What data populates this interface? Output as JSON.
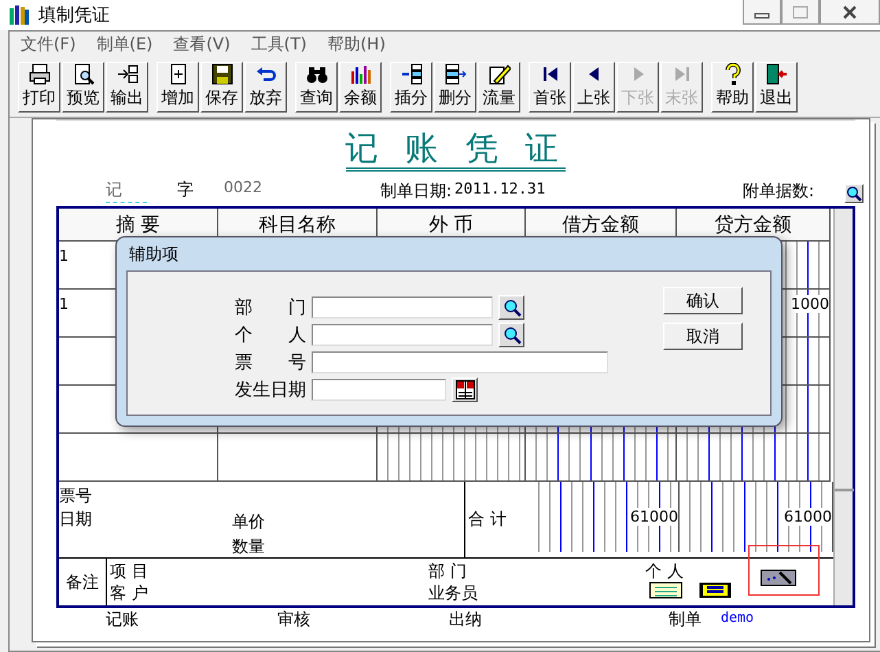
{
  "window": {
    "title": "填制凭证"
  },
  "menu": [
    {
      "label": "文件(F)"
    },
    {
      "label": "制单(E)"
    },
    {
      "label": "查看(V)"
    },
    {
      "label": "工具(T)"
    },
    {
      "label": "帮助(H)"
    }
  ],
  "toolbar": [
    {
      "buttons": [
        {
          "label": "打印",
          "disabled": false
        },
        {
          "label": "预览",
          "disabled": false
        },
        {
          "label": "输出",
          "disabled": false
        }
      ]
    },
    {
      "buttons": [
        {
          "label": "增加",
          "disabled": false
        },
        {
          "label": "保存",
          "disabled": false
        },
        {
          "label": "放弃",
          "disabled": false
        }
      ]
    },
    {
      "buttons": [
        {
          "label": "查询",
          "disabled": false
        },
        {
          "label": "余额",
          "disabled": false
        }
      ]
    },
    {
      "buttons": [
        {
          "label": "插分",
          "disabled": false
        },
        {
          "label": "删分",
          "disabled": false
        },
        {
          "label": "流量",
          "disabled": false
        }
      ]
    },
    {
      "buttons": [
        {
          "label": "首张",
          "disabled": false
        },
        {
          "label": "上张",
          "disabled": false
        },
        {
          "label": "下张",
          "disabled": true
        },
        {
          "label": "末张",
          "disabled": true
        }
      ]
    },
    {
      "buttons": [
        {
          "label": "帮助",
          "disabled": false
        },
        {
          "label": "退出",
          "disabled": false
        }
      ]
    }
  ],
  "voucher": {
    "title": "记 账 凭 证",
    "type": "记",
    "type_suffix": "字",
    "number": "0022",
    "date_label": "制单日期:",
    "date": "2011.12.31",
    "attachments_label": "附单据数:"
  },
  "table": {
    "columns": [
      "摘 要",
      "科目名称",
      "外 币",
      "借方金额",
      "贷方金额"
    ],
    "rows": [
      {
        "column_1": "1",
        "column_5": ""
      },
      {
        "column_1": "1",
        "column_5": "1000"
      }
    ]
  },
  "totals": {
    "invoice_label": "票号",
    "date_label": "日期",
    "unit_price_label": "单价",
    "quantity_label": "数量",
    "total_label": "合 计",
    "debit_total": "61000",
    "credit_total": "61000"
  },
  "remarks": {
    "label": "备注",
    "project_label": "项 目",
    "customer_label": "客 户",
    "department_label": "部 门",
    "salesperson_label": "业务员",
    "person_label": "个 人"
  },
  "signatures": [
    {
      "label": "记账"
    },
    {
      "label": "审核"
    },
    {
      "label": "出纳"
    },
    {
      "label": "制单",
      "value": "demo"
    }
  ],
  "dialog": {
    "title": "辅助项",
    "fields": [
      {
        "label": "部 门",
        "kind": "lookup"
      },
      {
        "label": "个 人",
        "kind": "lookup"
      },
      {
        "label": "票 号",
        "kind": "text"
      },
      {
        "label": "发生日期",
        "kind": "date"
      }
    ],
    "buttons": [
      {
        "label": "确认"
      },
      {
        "label": "取消"
      }
    ]
  }
}
